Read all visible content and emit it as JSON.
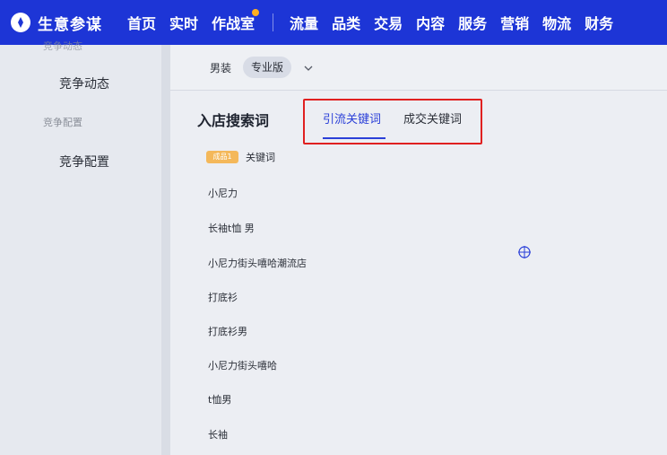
{
  "app": {
    "logo_text": "生意参谋"
  },
  "nav": {
    "left_items": [
      "首页",
      "实时",
      "作战室"
    ],
    "right_items": [
      "流量",
      "品类",
      "交易",
      "内容",
      "服务",
      "营销",
      "物流",
      "财务"
    ]
  },
  "sidebar": {
    "group_top_label": "竞争动态",
    "item_1": "竞争动态",
    "group_label": "竞争配置",
    "item_2": "竞争配置"
  },
  "filter": {
    "category": "男装",
    "version_pill": "专业版"
  },
  "section": {
    "title": "入店搜索词",
    "tabs": [
      {
        "label": "引流关键词",
        "active": true
      },
      {
        "label": "成交关键词",
        "active": false
      }
    ]
  },
  "table": {
    "tag_text": "成品1",
    "column_header": "关键词",
    "rows": [
      "小尼力",
      "长袖t恤 男",
      "小尼力街头嘻哈潮流店",
      "打底衫",
      "打底衫男",
      "小尼力街头嘻哈",
      "t恤男",
      "长袖"
    ]
  },
  "colors": {
    "nav_bg": "#1d35d6",
    "active_tab": "#2a3fd8",
    "highlight_box": "#e02020",
    "tag_bg": "#f4b85a"
  }
}
